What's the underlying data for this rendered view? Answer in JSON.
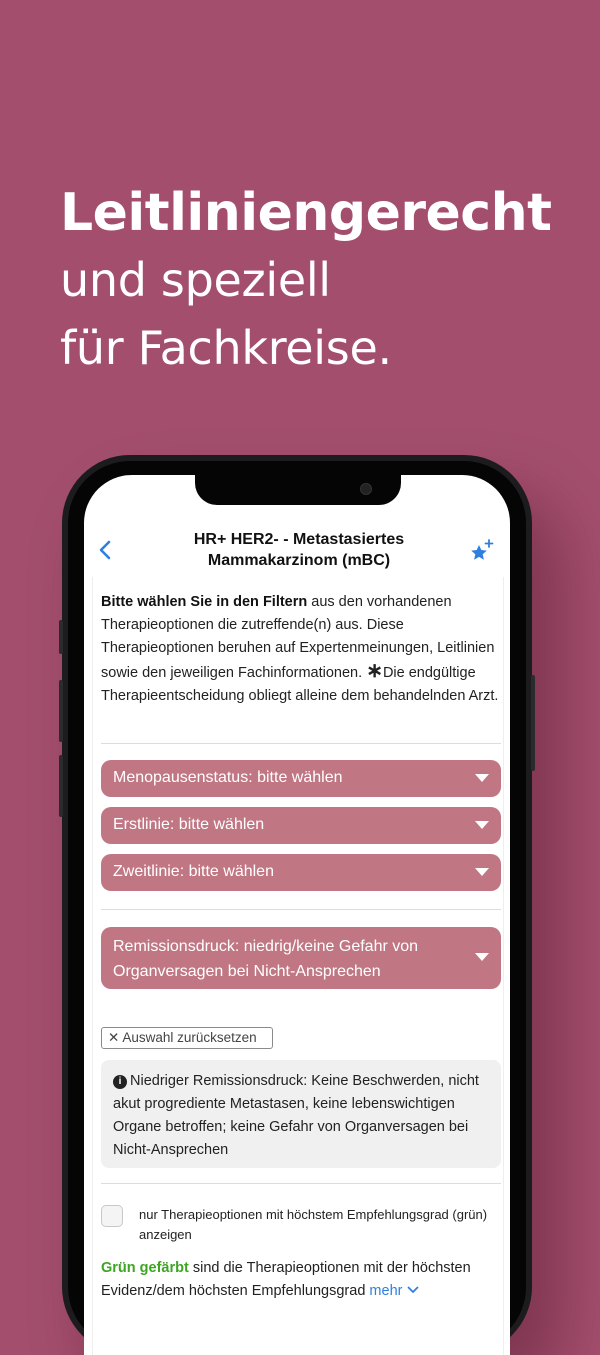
{
  "hero": {
    "line1": "Leitliniengerecht",
    "line2": "und speziell",
    "line3": "für Fachkreise."
  },
  "nav": {
    "title_line1": "HR+ HER2- - Metastasiertes",
    "title_line2": "Mammakarzinom (mBC)"
  },
  "intro": {
    "bold": "Bitte wählen Sie in den Filtern",
    "text1": " aus den vorhandenen Therapieoptionen die zutreffende(n) aus. Diese Therapieoptionen beruhen auf Expertenmeinungen, Leitlinien sowie den jeweiligen Fachinformationen. ",
    "asterisk": "∗",
    "text2": "Die endgültige Therapieentscheidung obliegt alleine dem behandelnden Arzt."
  },
  "filters": [
    {
      "label": "Menopausenstatus: bitte wählen"
    },
    {
      "label": "Erstlinie: bitte wählen"
    },
    {
      "label": "Zweitlinie: bitte wählen"
    },
    {
      "label": "Remissionsdruck: niedrig/keine Gefahr von Organversagen bei Nicht-Ansprechen"
    }
  ],
  "reset": {
    "label": "✕ Auswahl zurücksetzen"
  },
  "info": {
    "icon": "i",
    "text": "Niedriger Remissionsdruck: Keine Beschwerden, nicht akut progrediente Metastasen, keine lebenswichtigen Organe betroffen; keine Gefahr von Organversagen bei Nicht-Ansprechen"
  },
  "option": {
    "checkbox_label": "nur Therapieoptionen mit höchstem Empfehlungsgrad (grün) anzeigen"
  },
  "legend": {
    "green": "Grün gefärbt",
    "text": " sind die Therapieoptionen mit der höchsten Evidenz/dem höchsten Empfehlungsgrad ",
    "more": "mehr"
  },
  "colors": {
    "background": "#a34e6d",
    "select": "#c07783",
    "accent": "#2f7fe0",
    "green": "#3ea523"
  },
  "icons": {
    "back": "chevron-left-icon",
    "favorite": "star-plus-icon",
    "info": "info-circle-icon",
    "dropdown": "caret-down-icon",
    "more": "chevron-down-icon"
  }
}
